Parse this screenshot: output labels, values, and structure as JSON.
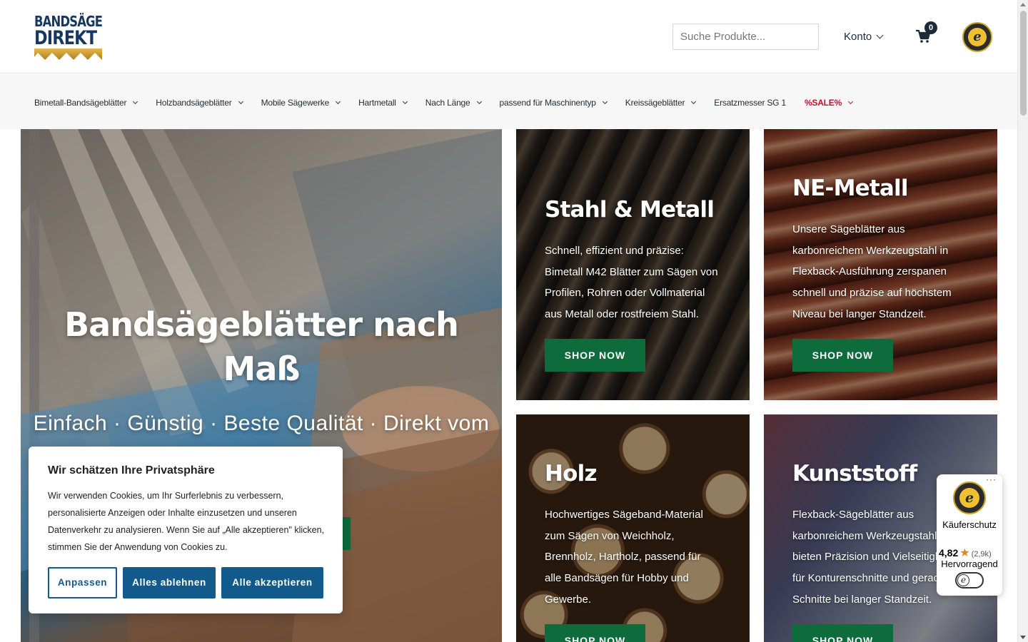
{
  "header": {
    "logo_line1": "BANDSÄGE",
    "logo_line2": "DIREKT",
    "search_placeholder": "Suche Produkte...",
    "account_label": "Konto",
    "cart_count": "0",
    "trust_seal_letter": "e"
  },
  "nav": {
    "items": [
      {
        "label": "Bimetall-Bandsägeblätter"
      },
      {
        "label": "Holzbandsägeblätter"
      },
      {
        "label": "Mobile Sägewerke"
      },
      {
        "label": "Hartmetall"
      },
      {
        "label": "Nach Länge"
      },
      {
        "label": "passend für Maschinentyp"
      },
      {
        "label": "Kreissägeblätter"
      },
      {
        "label": "Ersatzmesser SG 1"
      },
      {
        "label": "%SALE%"
      }
    ]
  },
  "hero": {
    "title": "Bandsägeblätter nach Maß",
    "subtitle": "Einfach · Günstig · Beste Qualität · Direkt vom"
  },
  "cards": [
    {
      "title": "Stahl & Metall",
      "text": "Schnell, effizient und präzise: Bimetall M42 Blätter zum Sägen von Profilen, Rohren oder Vollmaterial aus Metall oder rostfreiem Stahl.",
      "button": "SHOP NOW"
    },
    {
      "title": "NE-Metall",
      "text": "Unsere Sägeblätter aus karbonreichem Werkzeugstahl in Flexback-Ausführung zerspanen schnell und präzise auf höchstem Niveau bei langer Standzeit.",
      "button": "SHOP NOW"
    },
    {
      "title": "Holz",
      "text": "Hochwertiges Sägeband-Material zum Sägen von Weichholz, Brennholz, Hartholz, passend für alle Bandsägen für Hobby und Gewerbe.",
      "button": "SHOP NOW"
    },
    {
      "title": "Kunststoff",
      "text": "Flexback-Sägeblätter aus karbonreichem Werkzeugstahl bieten Präzision und Vielseitigkeit für Konturenschnitte und gerade Schnitte bei langer Standzeit.",
      "button": "SHOP NOW"
    }
  ],
  "cookie": {
    "title": "Wir schätzen Ihre Privatsphäre",
    "text": "Wir verwenden Cookies, um Ihr Surferlebnis zu verbessern, personalisierte Anzeigen oder Inhalte einzusetzen und unseren Datenverkehr zu analysieren. Wenn Sie auf „Alle akzeptieren\" klicken, stimmen Sie der Anwendung von Cookies zu.",
    "customize": "Anpassen",
    "reject": "Alles ablehnen",
    "accept": "Alle akzeptieren"
  },
  "trust_widget": {
    "menu": "···",
    "seal_letter": "e",
    "label": "Käuferschutz",
    "score": "4,82",
    "star": "★",
    "count": "(2,9k)",
    "verdict": "Hervorragend",
    "toggle_letter": "e"
  },
  "colors": {
    "brand_navy": "#16385f",
    "button_green": "#0e6b3c",
    "cookie_blue": "#125a8c",
    "sale_red": "#c3112f"
  }
}
